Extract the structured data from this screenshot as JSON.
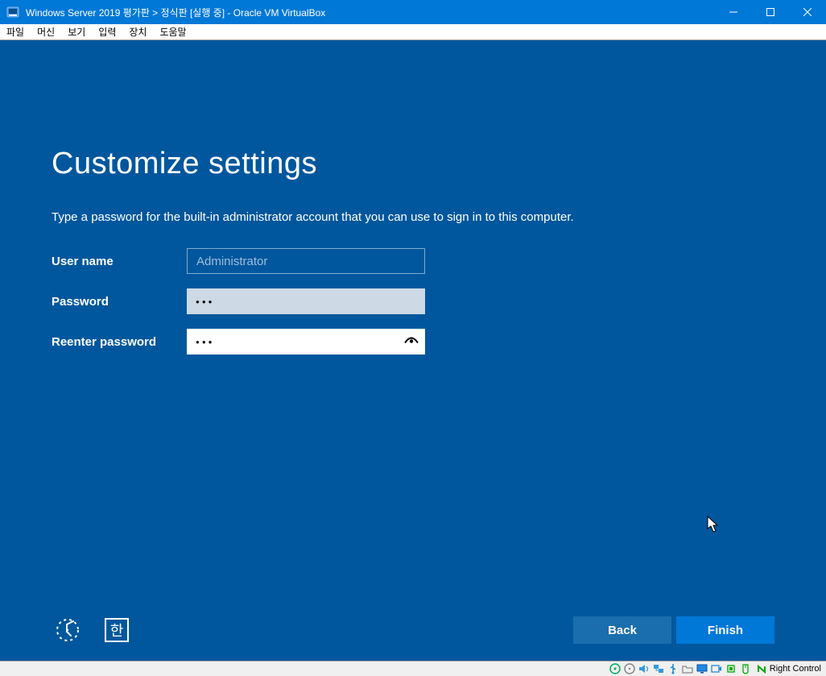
{
  "titlebar": {
    "title": "Windows Server 2019 평가판 > 정식판 [실행 중] - Oracle VM VirtualBox"
  },
  "menubar": [
    "파일",
    "머신",
    "보기",
    "입력",
    "장치",
    "도움말"
  ],
  "oobe": {
    "heading": "Customize settings",
    "description": "Type a password for the built-in administrator account that you can use to sign in to this computer.",
    "username_label": "User name",
    "username_value": "Administrator",
    "password_label": "Password",
    "password_value_masked": "●●●",
    "reenter_label": "Reenter password",
    "reenter_value_masked": "●●●",
    "ime_indicator": "한",
    "back_label": "Back",
    "finish_label": "Finish"
  },
  "statusbar": {
    "hostkey": "Right Control"
  }
}
